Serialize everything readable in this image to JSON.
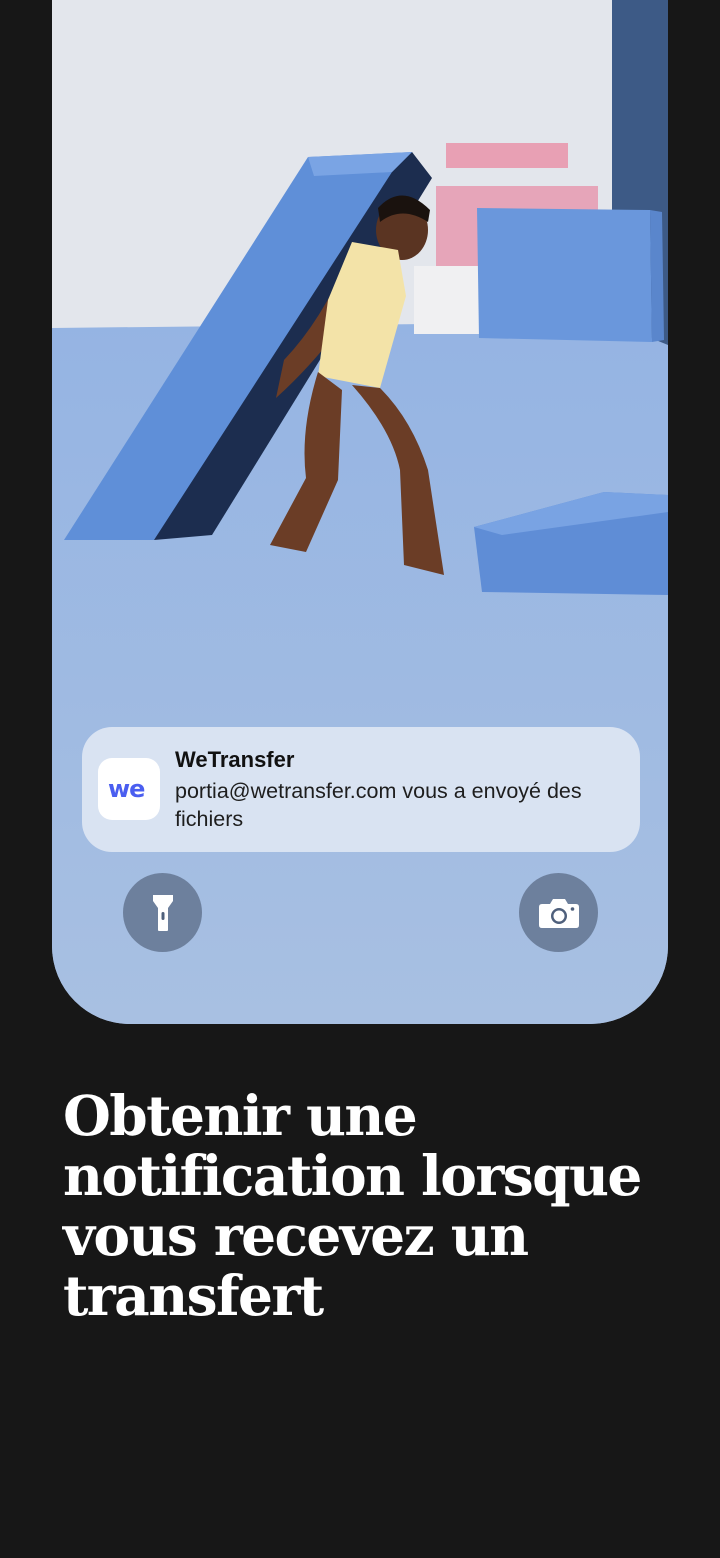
{
  "notification": {
    "app_name": "WeTransfer",
    "message": "portia@wetransfer.com vous a envoyé des fichiers",
    "app_icon": "wetransfer-logo",
    "logo_text": "we"
  },
  "lock_screen": {
    "left_button_icon": "flashlight-icon",
    "right_button_icon": "camera-icon"
  },
  "headline": "Obtenir une notification lorsque vous recevez un transfert",
  "colors": {
    "background": "#171717",
    "brand": "#4a5ef0",
    "notification_bg": "#e2e9f4",
    "headline": "#ffffff"
  }
}
